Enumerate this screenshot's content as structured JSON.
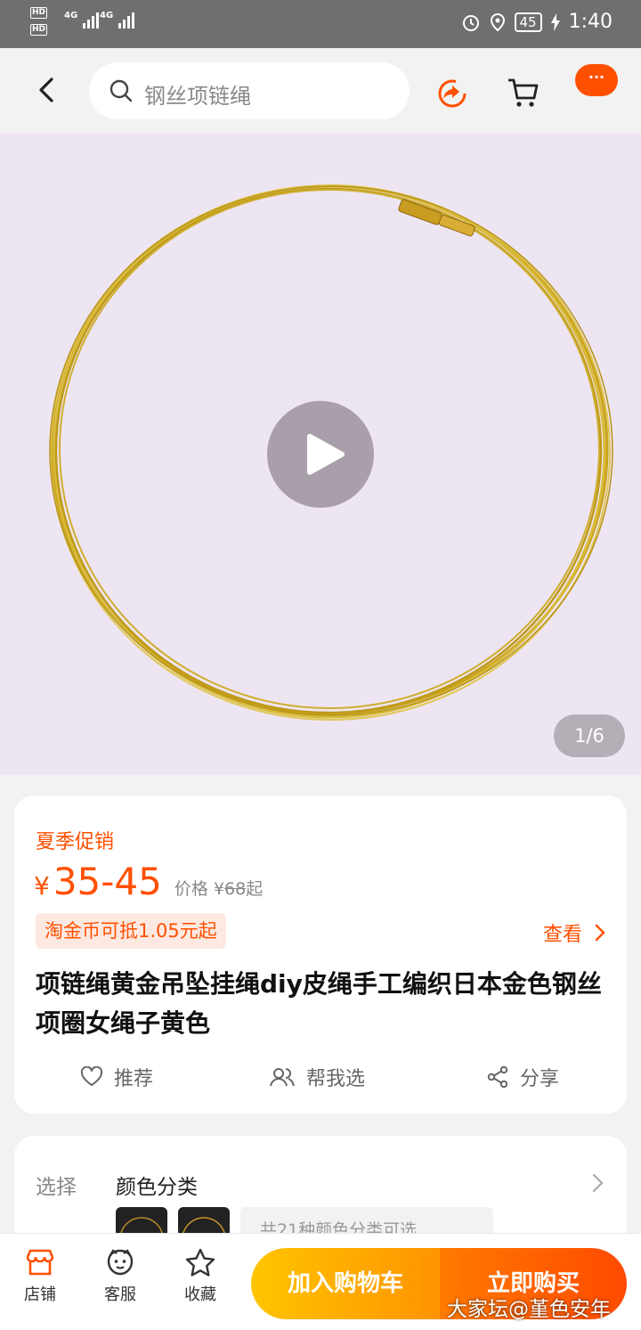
{
  "status_bar": {
    "sim1": "HD",
    "sim2": "HD",
    "network1": "4G",
    "network2": "4G",
    "battery": "45",
    "time": "1:40"
  },
  "header": {
    "search_placeholder": "钢丝项链绳",
    "more_label": "···"
  },
  "gallery": {
    "counter": "1/6"
  },
  "product": {
    "promo": "夏季促销",
    "currency": "¥",
    "price": "35-45",
    "orig_prefix": "价格",
    "orig_currency": "¥",
    "orig_price": "68",
    "orig_suffix": "起",
    "coin_offer": "淘金币可抵1.05元起",
    "view_label": "查看",
    "title": "项链绳黄金吊坠挂绳diy皮绳手工编织日本金色钢丝项圈女绳子黄色"
  },
  "actions": {
    "recommend": "推荐",
    "help_choose": "帮我选",
    "share": "分享"
  },
  "selection": {
    "label": "选择",
    "value": "颜色分类",
    "more_options": "共21种颜色分类可选"
  },
  "bottom_bar": {
    "shop": "店铺",
    "service": "客服",
    "favorite": "收藏",
    "add_to_cart": "加入购物车",
    "buy_now": "立即购买"
  },
  "watermark": "大家坛@堇色安年",
  "colors": {
    "accent": "#ff5000",
    "cart_gradient_start": "#ffc400",
    "buy_gradient_end": "#ff4a00",
    "gold": "#d4b32a"
  }
}
